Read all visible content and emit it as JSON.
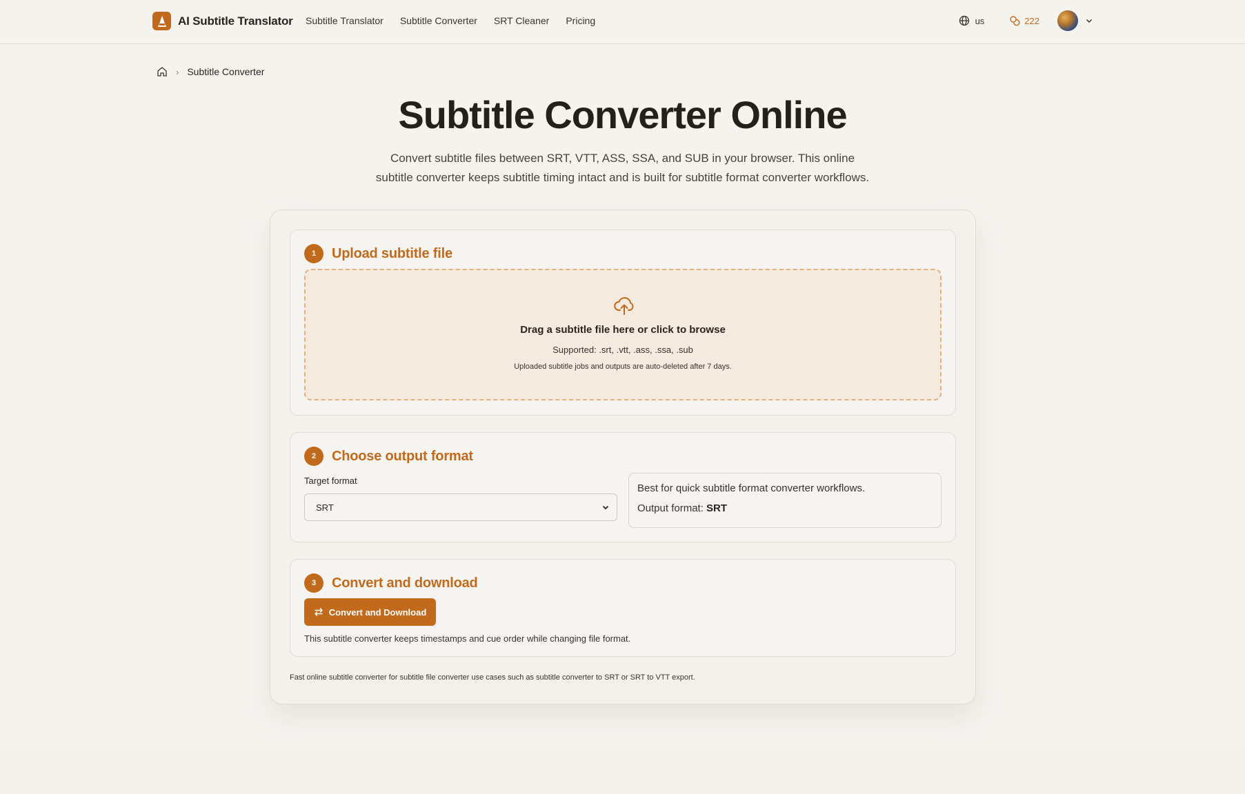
{
  "header": {
    "brand_name": "AI Subtitle Translator",
    "nav": [
      {
        "label": "Subtitle Translator"
      },
      {
        "label": "Subtitle Converter"
      },
      {
        "label": "SRT Cleaner"
      },
      {
        "label": "Pricing"
      }
    ],
    "language": "us",
    "credits": "222"
  },
  "breadcrumb": {
    "current": "Subtitle Converter"
  },
  "hero": {
    "title": "Subtitle Converter Online",
    "subtitle": "Convert subtitle files between SRT, VTT, ASS, SSA, and SUB in your browser. This online subtitle converter keeps subtitle timing intact and is built for subtitle format converter workflows."
  },
  "step1": {
    "number": "1",
    "title": "Upload subtitle file",
    "drop_text": "Drag a subtitle file here or click to browse",
    "supported": "Supported: .srt, .vtt, .ass, .ssa, .sub",
    "note": "Uploaded subtitle jobs and outputs are auto-deleted after 7 days."
  },
  "step2": {
    "number": "2",
    "title": "Choose output format",
    "target_label": "Target format",
    "selected_format": "SRT",
    "info_line": "Best for quick subtitle format converter workflows.",
    "output_label": "Output format:",
    "output_value": "SRT"
  },
  "step3": {
    "number": "3",
    "title": "Convert and download",
    "button_label": "Convert and Download",
    "note": "This subtitle converter keeps timestamps and cue order while changing file format."
  },
  "footer_note": "Fast online subtitle converter for subtitle file converter use cases such as subtitle converter to SRT or SRT to VTT export.",
  "colors": {
    "accent": "#c26a1c",
    "background": "#f5f3ee",
    "dropzone_bg": "#f5eadf",
    "dropzone_border": "#e3b27c"
  }
}
